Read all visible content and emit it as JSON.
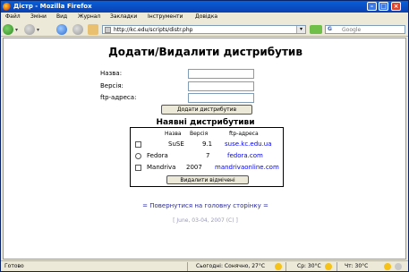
{
  "window": {
    "title": "Дістр - Mozilla Firefox"
  },
  "menubar": {
    "items": [
      "Файл",
      "Зміни",
      "Вид",
      "Журнал",
      "Закладки",
      "Інструменти",
      "Довідка"
    ]
  },
  "navbar": {
    "url": "http://kc.edu/scripts/distr.php",
    "search_engine": "G",
    "search_placeholder": "Google"
  },
  "page": {
    "title": "Додати/Видалити дистрибутив",
    "form": {
      "name_label": "Назва:",
      "version_label": "Версія:",
      "ftp_label": "ftp-адреса:",
      "add_button": "Додати дистрибутив"
    },
    "section_title": "Наявні дистрибутиви",
    "table": {
      "headers": [
        "Назва",
        "Версія",
        "ftp-адреса"
      ],
      "rows": [
        {
          "name": "SuSE",
          "version": "9.1",
          "ftp": "suse.kc.edu.ua"
        },
        {
          "name": "Fedora",
          "version": "7",
          "ftp": "fedora.com"
        },
        {
          "name": "Mandriva",
          "version": "2007",
          "ftp": "mandrivaonline.com"
        }
      ]
    },
    "delete_button": "Видалити відмічені",
    "home_link": "= Повернутися на головну сторінку =",
    "footer": "[ June, 03-04, 2007 (C) ]"
  },
  "statusbar": {
    "status": "Готово",
    "weather_today": "Сьогодні: Сонячно, 27°C",
    "weather_day2": "Ср: 30°C",
    "weather_day3": "Чт: 30°C"
  },
  "colors": {
    "titlebar": "#0a4fc8",
    "link": "#0000ee",
    "chrome": "#ece9d8"
  }
}
